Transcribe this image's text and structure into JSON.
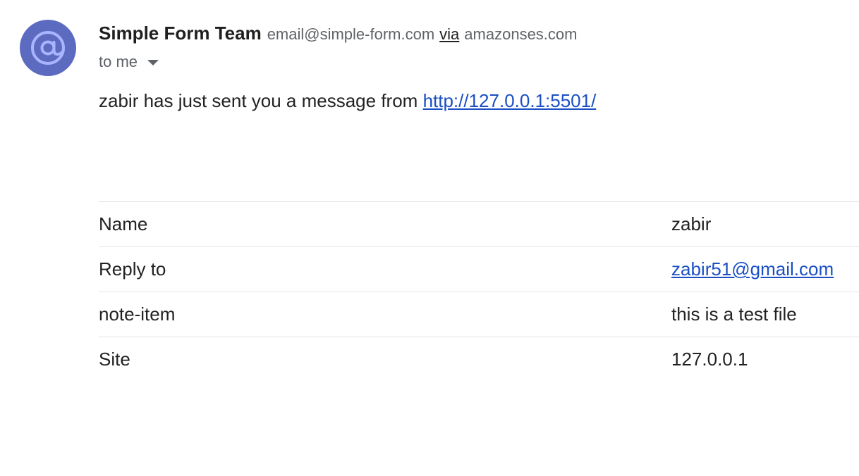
{
  "sender": {
    "avatar_icon": "at-sign-icon",
    "avatar_color": "#5c6bc0",
    "name": "Simple Form Team",
    "email": "email@simple-form.com",
    "via_label": "via",
    "via_domain": "amazonses.com"
  },
  "recipient": {
    "label": "to me",
    "dropdown_icon": "caret-down-icon"
  },
  "message": {
    "text": "zabir has just sent you a message from",
    "link": "http://127.0.0.1:5501/"
  },
  "fields": {
    "rows": [
      {
        "label": "Name",
        "value": "zabir"
      },
      {
        "label": "Reply to",
        "value": "zabir51@gmail.com"
      },
      {
        "label": "note-item",
        "value": "this is a test file"
      },
      {
        "label": "Site",
        "value": "127.0.0.1"
      }
    ]
  },
  "colors": {
    "link": "#1a4fc4",
    "muted": "#5f6368",
    "divider": "#e3e3e3"
  }
}
